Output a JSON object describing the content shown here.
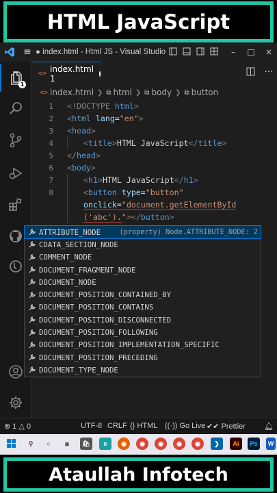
{
  "banner": {
    "top": "HTML JavaScript",
    "bottom": "Ataullah Infotech"
  },
  "titlebar": {
    "title": "● index.html - Html JS - Visual Studio ...",
    "minimize": "–",
    "restore": "□",
    "close": "×"
  },
  "activity": {
    "explorer_badge": "1"
  },
  "tab": {
    "label": "index.html 1"
  },
  "breadcrumb": {
    "file": "index.html",
    "html": "html",
    "body": "body",
    "button": "button"
  },
  "editor": {
    "line_numbers": [
      "1",
      "2",
      "3",
      "4",
      "5",
      "6",
      "7",
      "8"
    ],
    "l1": {
      "a": "<!DOCTYPE ",
      "b": "html",
      "c": ">"
    },
    "l2": {
      "a": "<",
      "b": "html ",
      "c": "lang",
      "d": "=",
      "e": "\"en\"",
      "f": ">"
    },
    "l3": {
      "a": "<",
      "b": "head",
      "c": ">"
    },
    "l4": {
      "a": "<",
      "b": "title",
      "c": ">",
      "d": "HTML JavaScript",
      "e": "</",
      "f": "title",
      "g": ">"
    },
    "l5": {
      "a": "</",
      "b": "head",
      "c": ">"
    },
    "l6": {
      "a": "<",
      "b": "body",
      "c": ">"
    },
    "l7": {
      "a": "<",
      "b": "h1",
      "c": ">",
      "d": "HTML JavaScript",
      "e": "</",
      "f": "h1",
      "g": ">"
    },
    "l8": {
      "a": "<",
      "b": "button ",
      "c": "type",
      "d": "=",
      "e": "\"button\""
    },
    "l8b": {
      "a": "onclick",
      "b": "=",
      "c": "\"document.getElementById"
    },
    "l8c": {
      "a": "('abc').",
      "b": "\"",
      "c": "></",
      "d": "button",
      "e": ">"
    }
  },
  "suggest": {
    "detail": "(property) Node.ATTRIBUTE_NODE: 2",
    "items": [
      "ATTRIBUTE_NODE",
      "CDATA_SECTION_NODE",
      "COMMENT_NODE",
      "DOCUMENT_FRAGMENT_NODE",
      "DOCUMENT_NODE",
      "DOCUMENT_POSITION_CONTAINED_BY",
      "DOCUMENT_POSITION_CONTAINS",
      "DOCUMENT_POSITION_DISCONNECTED",
      "DOCUMENT_POSITION_FOLLOWING",
      "DOCUMENT_POSITION_IMPLEMENTATION_SPECIFIC",
      "DOCUMENT_POSITION_PRECEDING",
      "DOCUMENT_TYPE_NODE"
    ]
  },
  "status": {
    "errors": "1",
    "warnings": "0",
    "encoding": "UTF-8",
    "eol": "CRLF",
    "language": "HTML",
    "golive": "Go Live",
    "prettier": "Prettier"
  },
  "taskbar": {
    "ai": "Ai",
    "ps": "Ps",
    "w": "W"
  },
  "colors": {
    "accent": "#21c6a5",
    "tag": "#569cd6",
    "attr": "#9cdcfe",
    "string": "#ce9178",
    "selection": "#04395e"
  }
}
